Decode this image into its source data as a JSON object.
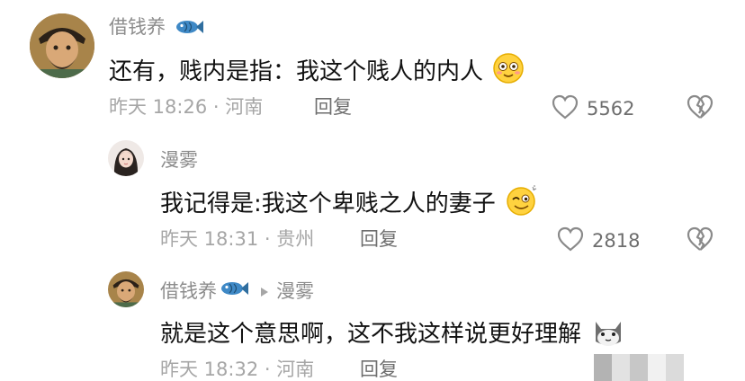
{
  "comments": [
    {
      "name": "借钱养",
      "text": "还有，贱内是指：我这个贱人的内人",
      "meta": "昨天 18:26 · 河南",
      "reply_label": "回复",
      "like_count": "5562"
    },
    {
      "name": "漫雾",
      "text": "我记得是:我这个卑贱之人的妻子",
      "meta": "昨天 18:31 · 贵州",
      "reply_label": "回复",
      "like_count": "2818"
    },
    {
      "name": "借钱养",
      "reply_to": "漫雾",
      "text": "就是这个意思啊，这不我这样说更好理解",
      "meta": "昨天 18:32 · 河南",
      "reply_label": "回复"
    }
  ],
  "icons": {
    "fish": "fish-badge-icon",
    "emoji_blush": "blush-emoji-icon",
    "emoji_wink": "wink-emoji-icon",
    "emoji_cat": "cat-emoji-icon",
    "like": "heart-icon",
    "dislike": "broken-heart-icon",
    "reply_arrow": "triangle-arrow-icon"
  },
  "colors": {
    "name": "#8c8c8c",
    "meta": "#a6a6a6",
    "text": "#111111",
    "icon": "#8a8a8a"
  }
}
